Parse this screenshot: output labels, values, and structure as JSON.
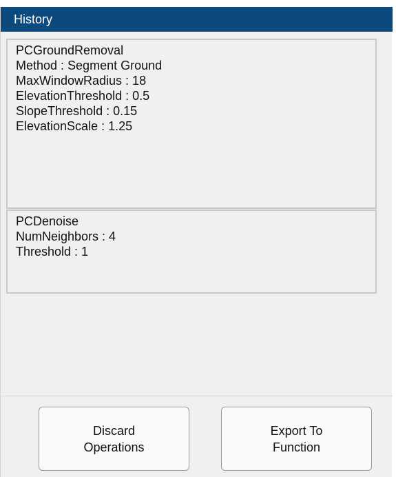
{
  "panel": {
    "title": "History"
  },
  "history": {
    "items": [
      {
        "name": "PCGroundRemoval",
        "params": [
          "Method : Segment Ground",
          "MaxWindowRadius : 18",
          "ElevationThreshold : 0.5",
          "SlopeThreshold : 0.15",
          "ElevationScale : 1.25"
        ]
      },
      {
        "name": "PCDenoise",
        "params": [
          "NumNeighbors : 4",
          "Threshold : 1"
        ]
      }
    ]
  },
  "buttons": {
    "discard": [
      "Discard",
      "Operations"
    ],
    "export": [
      "Export To",
      "Function"
    ]
  },
  "colors": {
    "title_bar": "#0c4a7e",
    "panel_bg": "#f0f0f0",
    "item_border": "#c8c8c8"
  }
}
